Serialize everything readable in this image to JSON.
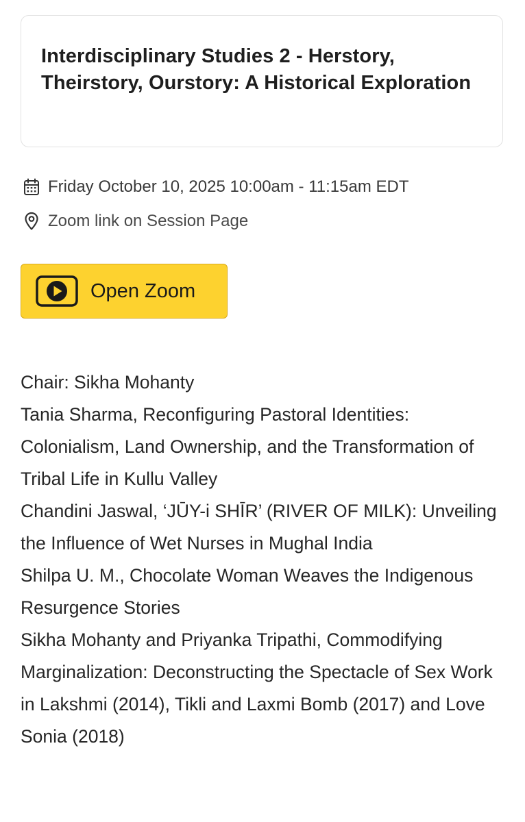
{
  "session": {
    "title": "Interdisciplinary Studies 2 - Herstory, Theirstory, Ourstory: A Historical Exploration",
    "datetime": "Friday October 10, 2025 10:00am - 11:15am EDT",
    "location": "Zoom link on Session Page",
    "calendar_icon": "calendar-icon",
    "location_icon": "map-pin-icon"
  },
  "zoom_button": {
    "label": "Open Zoom",
    "icon": "play-icon",
    "color": "#fdd22f"
  },
  "description": [
    "Chair: Sikha Mohanty",
    "Tania Sharma, Reconfiguring Pastoral Identities: Colonialism, Land Ownership, and the Transformation of Tribal Life in Kullu Valley",
    "Chandini Jaswal, ‘JŪY-i SHĪR’ (RIVER OF MILK): Unveiling the Influence of Wet Nurses in Mughal India",
    "Shilpa U. M., Chocolate Woman Weaves the Indigenous Resurgence Stories",
    "Sikha Mohanty and Priyanka Tripathi, Commodifying Marginalization: Deconstructing the Spectacle of Sex Work in Lakshmi (2014), Tikli and Laxmi Bomb (2017) and Love Sonia (2018)"
  ]
}
